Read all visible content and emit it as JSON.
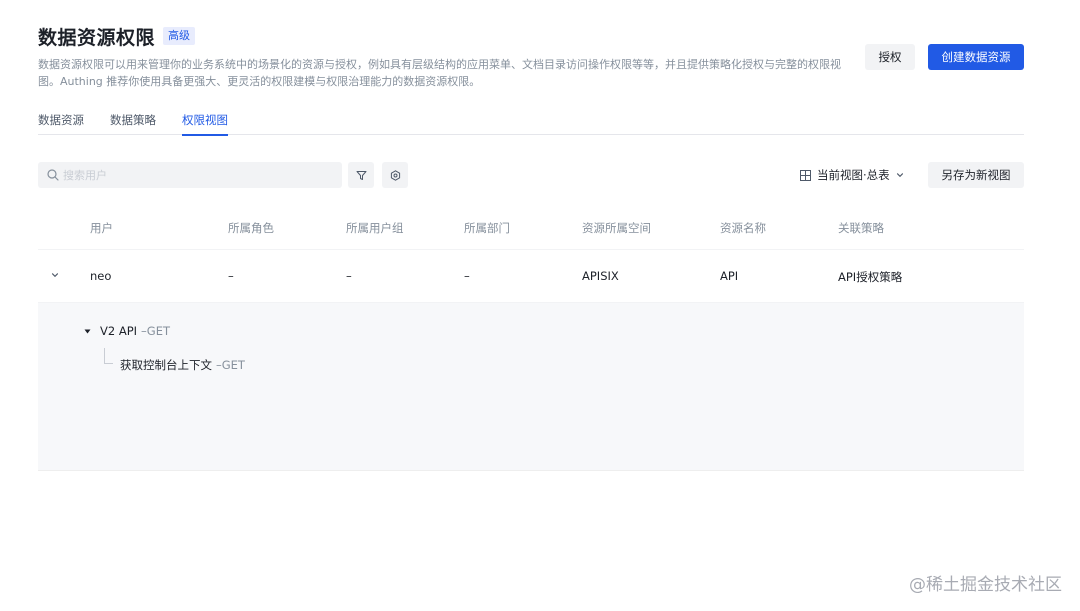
{
  "header": {
    "title": "数据资源权限",
    "badge": "高级",
    "description": "数据资源权限可以用来管理你的业务系统中的场景化的资源与授权，例如具有层级结构的应用菜单、文档目录访问操作权限等等，并且提供策略化授权与完整的权限视图。Authing 推荐你使用具备更强大、更灵活的权限建模与权限治理能力的数据资源权限。"
  },
  "actions": {
    "authorize_label": "授权",
    "create_label": "创建数据资源"
  },
  "tabs": [
    {
      "label": "数据资源",
      "active": false
    },
    {
      "label": "数据策略",
      "active": false
    },
    {
      "label": "权限视图",
      "active": true
    }
  ],
  "toolbar": {
    "search_placeholder": "搜索用户",
    "filter_icon": "filter-icon",
    "settings_icon": "gear-icon",
    "view_label": "当前视图·总表",
    "save_view_label": "另存为新视图"
  },
  "table": {
    "columns": [
      "用户",
      "所属角色",
      "所属用户组",
      "所属部门",
      "资源所属空间",
      "资源名称",
      "关联策略"
    ],
    "rows": [
      {
        "cells": [
          "neo",
          "–",
          "–",
          "–",
          "APISIX",
          "API",
          "API授权策略"
        ],
        "expanded": true,
        "children": [
          {
            "name": "V2 API",
            "method": "–GET",
            "children": [
              {
                "name": "获取控制台上下文",
                "method": "–GET"
              }
            ]
          }
        ]
      }
    ]
  },
  "watermark": "@稀土掘金技术社区",
  "colors": {
    "primary": "#215ae5",
    "text": "#1d2129",
    "muted": "#86909c",
    "button_grey": "#f2f3f5",
    "detail_bg": "#f7f8fa"
  }
}
